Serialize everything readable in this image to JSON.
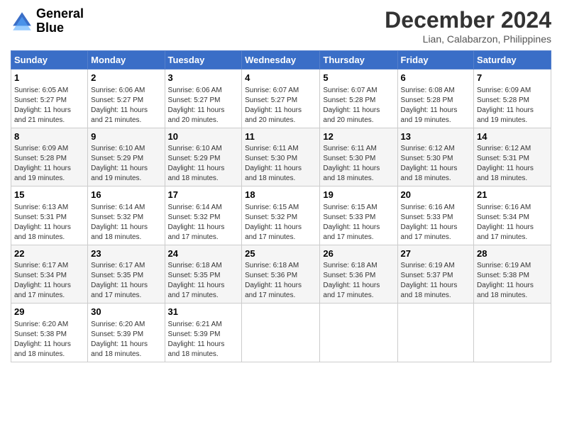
{
  "logo": {
    "line1": "General",
    "line2": "Blue"
  },
  "title": "December 2024",
  "location": "Lian, Calabarzon, Philippines",
  "weekdays": [
    "Sunday",
    "Monday",
    "Tuesday",
    "Wednesday",
    "Thursday",
    "Friday",
    "Saturday"
  ],
  "weeks": [
    [
      {
        "day": "1",
        "info": "Sunrise: 6:05 AM\nSunset: 5:27 PM\nDaylight: 11 hours\nand 21 minutes."
      },
      {
        "day": "2",
        "info": "Sunrise: 6:06 AM\nSunset: 5:27 PM\nDaylight: 11 hours\nand 21 minutes."
      },
      {
        "day": "3",
        "info": "Sunrise: 6:06 AM\nSunset: 5:27 PM\nDaylight: 11 hours\nand 20 minutes."
      },
      {
        "day": "4",
        "info": "Sunrise: 6:07 AM\nSunset: 5:27 PM\nDaylight: 11 hours\nand 20 minutes."
      },
      {
        "day": "5",
        "info": "Sunrise: 6:07 AM\nSunset: 5:28 PM\nDaylight: 11 hours\nand 20 minutes."
      },
      {
        "day": "6",
        "info": "Sunrise: 6:08 AM\nSunset: 5:28 PM\nDaylight: 11 hours\nand 19 minutes."
      },
      {
        "day": "7",
        "info": "Sunrise: 6:09 AM\nSunset: 5:28 PM\nDaylight: 11 hours\nand 19 minutes."
      }
    ],
    [
      {
        "day": "8",
        "info": "Sunrise: 6:09 AM\nSunset: 5:28 PM\nDaylight: 11 hours\nand 19 minutes."
      },
      {
        "day": "9",
        "info": "Sunrise: 6:10 AM\nSunset: 5:29 PM\nDaylight: 11 hours\nand 19 minutes."
      },
      {
        "day": "10",
        "info": "Sunrise: 6:10 AM\nSunset: 5:29 PM\nDaylight: 11 hours\nand 18 minutes."
      },
      {
        "day": "11",
        "info": "Sunrise: 6:11 AM\nSunset: 5:30 PM\nDaylight: 11 hours\nand 18 minutes."
      },
      {
        "day": "12",
        "info": "Sunrise: 6:11 AM\nSunset: 5:30 PM\nDaylight: 11 hours\nand 18 minutes."
      },
      {
        "day": "13",
        "info": "Sunrise: 6:12 AM\nSunset: 5:30 PM\nDaylight: 11 hours\nand 18 minutes."
      },
      {
        "day": "14",
        "info": "Sunrise: 6:12 AM\nSunset: 5:31 PM\nDaylight: 11 hours\nand 18 minutes."
      }
    ],
    [
      {
        "day": "15",
        "info": "Sunrise: 6:13 AM\nSunset: 5:31 PM\nDaylight: 11 hours\nand 18 minutes."
      },
      {
        "day": "16",
        "info": "Sunrise: 6:14 AM\nSunset: 5:32 PM\nDaylight: 11 hours\nand 18 minutes."
      },
      {
        "day": "17",
        "info": "Sunrise: 6:14 AM\nSunset: 5:32 PM\nDaylight: 11 hours\nand 17 minutes."
      },
      {
        "day": "18",
        "info": "Sunrise: 6:15 AM\nSunset: 5:32 PM\nDaylight: 11 hours\nand 17 minutes."
      },
      {
        "day": "19",
        "info": "Sunrise: 6:15 AM\nSunset: 5:33 PM\nDaylight: 11 hours\nand 17 minutes."
      },
      {
        "day": "20",
        "info": "Sunrise: 6:16 AM\nSunset: 5:33 PM\nDaylight: 11 hours\nand 17 minutes."
      },
      {
        "day": "21",
        "info": "Sunrise: 6:16 AM\nSunset: 5:34 PM\nDaylight: 11 hours\nand 17 minutes."
      }
    ],
    [
      {
        "day": "22",
        "info": "Sunrise: 6:17 AM\nSunset: 5:34 PM\nDaylight: 11 hours\nand 17 minutes."
      },
      {
        "day": "23",
        "info": "Sunrise: 6:17 AM\nSunset: 5:35 PM\nDaylight: 11 hours\nand 17 minutes."
      },
      {
        "day": "24",
        "info": "Sunrise: 6:18 AM\nSunset: 5:35 PM\nDaylight: 11 hours\nand 17 minutes."
      },
      {
        "day": "25",
        "info": "Sunrise: 6:18 AM\nSunset: 5:36 PM\nDaylight: 11 hours\nand 17 minutes."
      },
      {
        "day": "26",
        "info": "Sunrise: 6:18 AM\nSunset: 5:36 PM\nDaylight: 11 hours\nand 17 minutes."
      },
      {
        "day": "27",
        "info": "Sunrise: 6:19 AM\nSunset: 5:37 PM\nDaylight: 11 hours\nand 18 minutes."
      },
      {
        "day": "28",
        "info": "Sunrise: 6:19 AM\nSunset: 5:38 PM\nDaylight: 11 hours\nand 18 minutes."
      }
    ],
    [
      {
        "day": "29",
        "info": "Sunrise: 6:20 AM\nSunset: 5:38 PM\nDaylight: 11 hours\nand 18 minutes."
      },
      {
        "day": "30",
        "info": "Sunrise: 6:20 AM\nSunset: 5:39 PM\nDaylight: 11 hours\nand 18 minutes."
      },
      {
        "day": "31",
        "info": "Sunrise: 6:21 AM\nSunset: 5:39 PM\nDaylight: 11 hours\nand 18 minutes."
      },
      null,
      null,
      null,
      null
    ]
  ]
}
